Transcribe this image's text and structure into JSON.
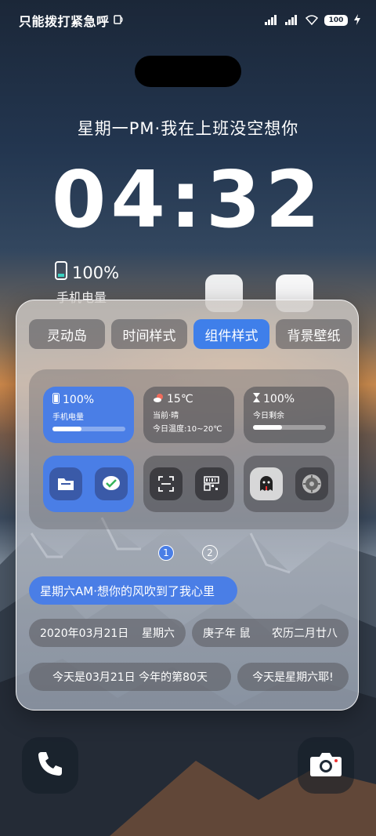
{
  "status_bar": {
    "carrier_text": "只能拨打紧急呼",
    "battery_level": "100"
  },
  "lockscreen": {
    "subtitle": "星期一PM·我在上班没空想你",
    "time": "04:32",
    "battery_percent": "100%",
    "battery_label": "手机电量"
  },
  "panel": {
    "tabs": [
      "灵动岛",
      "时间样式",
      "组件样式",
      "背景壁纸"
    ],
    "active_tab": 2,
    "widgets": {
      "battery": {
        "value": "100%",
        "label": "手机电量",
        "fill": 0.4
      },
      "weather": {
        "value": "15℃",
        "line1": "当前·晴",
        "line2": "今日温度:10~20℃"
      },
      "remaining": {
        "value": "100%",
        "label": "今日剩余",
        "fill": 0.4
      }
    },
    "pages": [
      "1",
      "2"
    ],
    "active_page": 0,
    "text_styles": {
      "selected": "星期六AM·想你的风吹到了我心里",
      "date": "2020年03月21日",
      "weekday": "星期六",
      "zodiac": "庚子年 鼠",
      "lunar": "农历二月廿八",
      "day_info": "今天是03月21日   今年的第80天",
      "day_note": "今天是星期六耶!"
    }
  },
  "dock": {
    "left_icon": "phone-icon",
    "right_icon": "camera-icon"
  },
  "colors": {
    "accent": "#4a7ee6",
    "panel": "#c8c6c4"
  }
}
